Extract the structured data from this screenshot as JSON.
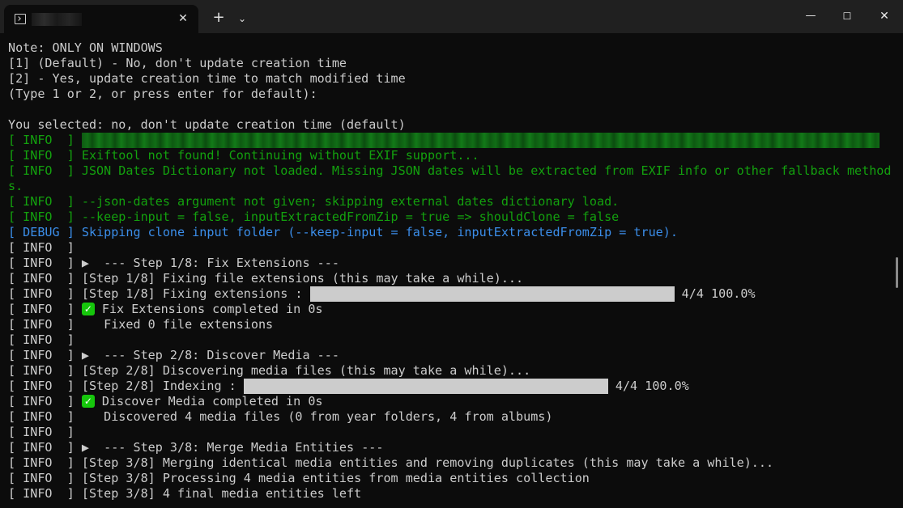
{
  "titlebar": {
    "tab_title": "",
    "tab_close": "✕",
    "new_tab": "+",
    "dropdown": "⌄",
    "minimize": "—",
    "maximize": "☐",
    "close": "✕"
  },
  "terminal": {
    "note": "Note: ONLY ON WINDOWS",
    "opt1": "[1] (Default) - No, don't update creation time",
    "opt2": "[2] - Yes, update creation time to match modified time",
    "prompt": "(Type 1 or 2, or press enter for default):",
    "blank": "",
    "selected": "You selected: no, don't update creation time (default)",
    "info_tag": "[ INFO  ] ",
    "debug_tag": "[ DEBUG ] ",
    "l_exiftool": "Exiftool not found! Continuing without EXIF support...",
    "l_json1": "JSON Dates Dictionary not loaded. Missing JSON dates will be extracted from EXIF info or other fallback method",
    "l_json1_wrap": "s.",
    "l_jsonarg": "--json-dates argument not given; skipping external dates dictionary load.",
    "l_keep": "--keep-input = false, inputExtractedFromZip = true => shouldClone = false",
    "l_debug": "Skipping clone input folder (--keep-input = false, inputExtractedFromZip = true).",
    "s1_header": "▶  --- Step 1/8: Fix Extensions ---",
    "s1_fixing": "[Step 1/8] Fixing file extensions (this may take a while)...",
    "s1_progress_label": "[Step 1/8] Fixing extensions : ",
    "s1_progress_text": " 4/4 100.0%",
    "s1_progress": 1.0,
    "s1_done": "Fix Extensions completed in 0s",
    "s1_fixed": "   Fixed 0 file extensions",
    "s2_header": "▶  --- Step 2/8: Discover Media ---",
    "s2_disc": "[Step 2/8] Discovering media files (this may take a while)...",
    "s2_progress_label": "[Step 2/8] Indexing : ",
    "s2_progress_text": " 4/4 100.0%",
    "s2_progress": 1.0,
    "s2_done": "Discover Media completed in 0s",
    "s2_found": "   Discovered 4 media files (0 from year folders, 4 from albums)",
    "s3_header": "▶  --- Step 3/8: Merge Media Entities ---",
    "s3_merge": "[Step 3/8] Merging identical media entities and removing duplicates (this may take a while)...",
    "s3_proc": "[Step 3/8] Processing 4 media entities from media entities collection",
    "s3_left": "[Step 3/8] 4 final media entities left",
    "check_glyph": "✓"
  },
  "colors": {
    "background": "#0c0c0c",
    "info_green": "#13a10e",
    "debug_blue": "#3b8eea",
    "text": "#cccccc",
    "check": "#16c60c"
  }
}
